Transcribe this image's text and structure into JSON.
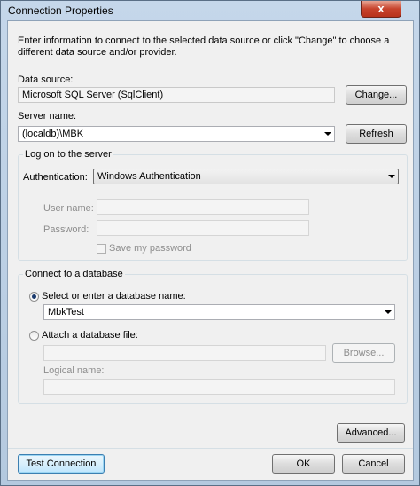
{
  "window": {
    "title": "Connection Properties",
    "close_glyph": "x"
  },
  "intro": "Enter information to connect to the selected data source or click \"Change\" to choose a different data source and/or provider.",
  "data_source": {
    "label": "Data source:",
    "value": "Microsoft SQL Server (SqlClient)",
    "change_button": "Change..."
  },
  "server": {
    "label": "Server name:",
    "value": "(localdb)\\MBK",
    "refresh_button": "Refresh"
  },
  "logon": {
    "group_title": "Log on to the server",
    "auth_label": "Authentication:",
    "auth_value": "Windows Authentication",
    "user_label": "User name:",
    "password_label": "Password:",
    "save_password_label": "Save my password"
  },
  "database": {
    "group_title": "Connect to a database",
    "select_label": "Select or enter a database name:",
    "db_value": "MbkTest",
    "attach_label": "Attach a database file:",
    "browse_button": "Browse...",
    "logical_name_label": "Logical name:"
  },
  "buttons": {
    "advanced": "Advanced...",
    "test": "Test Connection",
    "ok": "OK",
    "cancel": "Cancel"
  }
}
